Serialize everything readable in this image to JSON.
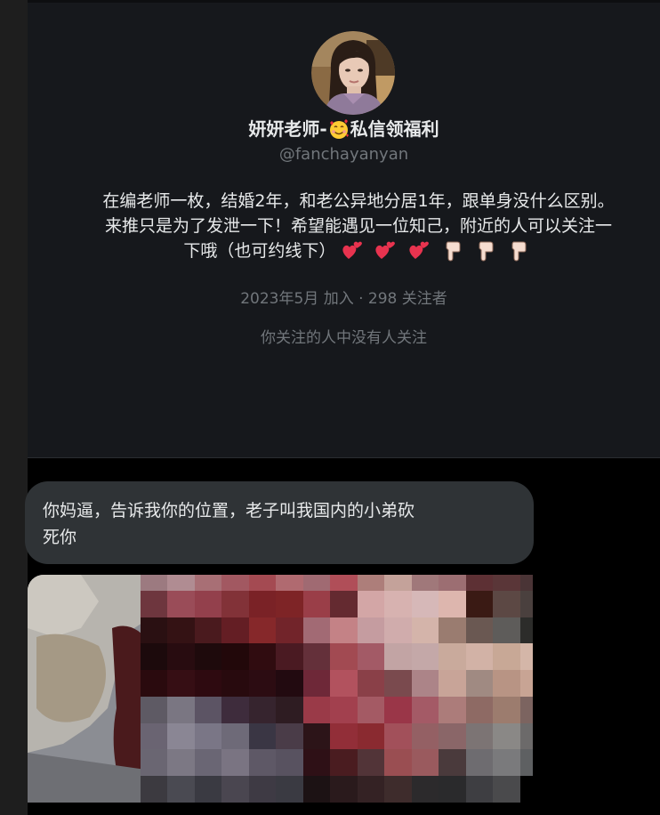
{
  "profile": {
    "display_name_prefix": "妍妍老师-",
    "display_name_suffix": "私信领福利",
    "handle": "@fanchayanyan",
    "bio_line1": "在编老师一枚，结婚2年，和老公异地分居1年，跟单身没什么区别。",
    "bio_line2": "来推只是为了发泄一下！希望能遇见一位知己，附近的人可以关注一",
    "bio_line3": "下哦（也可约线下）",
    "bio_emojis": [
      "two-hearts-icon",
      "two-hearts-icon",
      "two-hearts-icon",
      "pointing-down-icon",
      "pointing-down-icon",
      "pointing-down-icon"
    ],
    "name_emoji": "smiling-face-with-hearts-icon",
    "meta": "2023年5月 加入 · 298 关注者",
    "followed_by": "你关注的人中没有人关注"
  },
  "message": {
    "text_line1": "你妈逼，告诉我你的位置，老子叫我国内的小弟砍",
    "text_line2": "死你"
  },
  "attachment": {
    "kind": "pixelated-image"
  },
  "colors": {
    "card_bg": "#16181c",
    "page_bg": "#000000",
    "bubble_bg": "#2f3336",
    "text_primary": "#e7e9ea",
    "text_secondary": "#71767b"
  }
}
